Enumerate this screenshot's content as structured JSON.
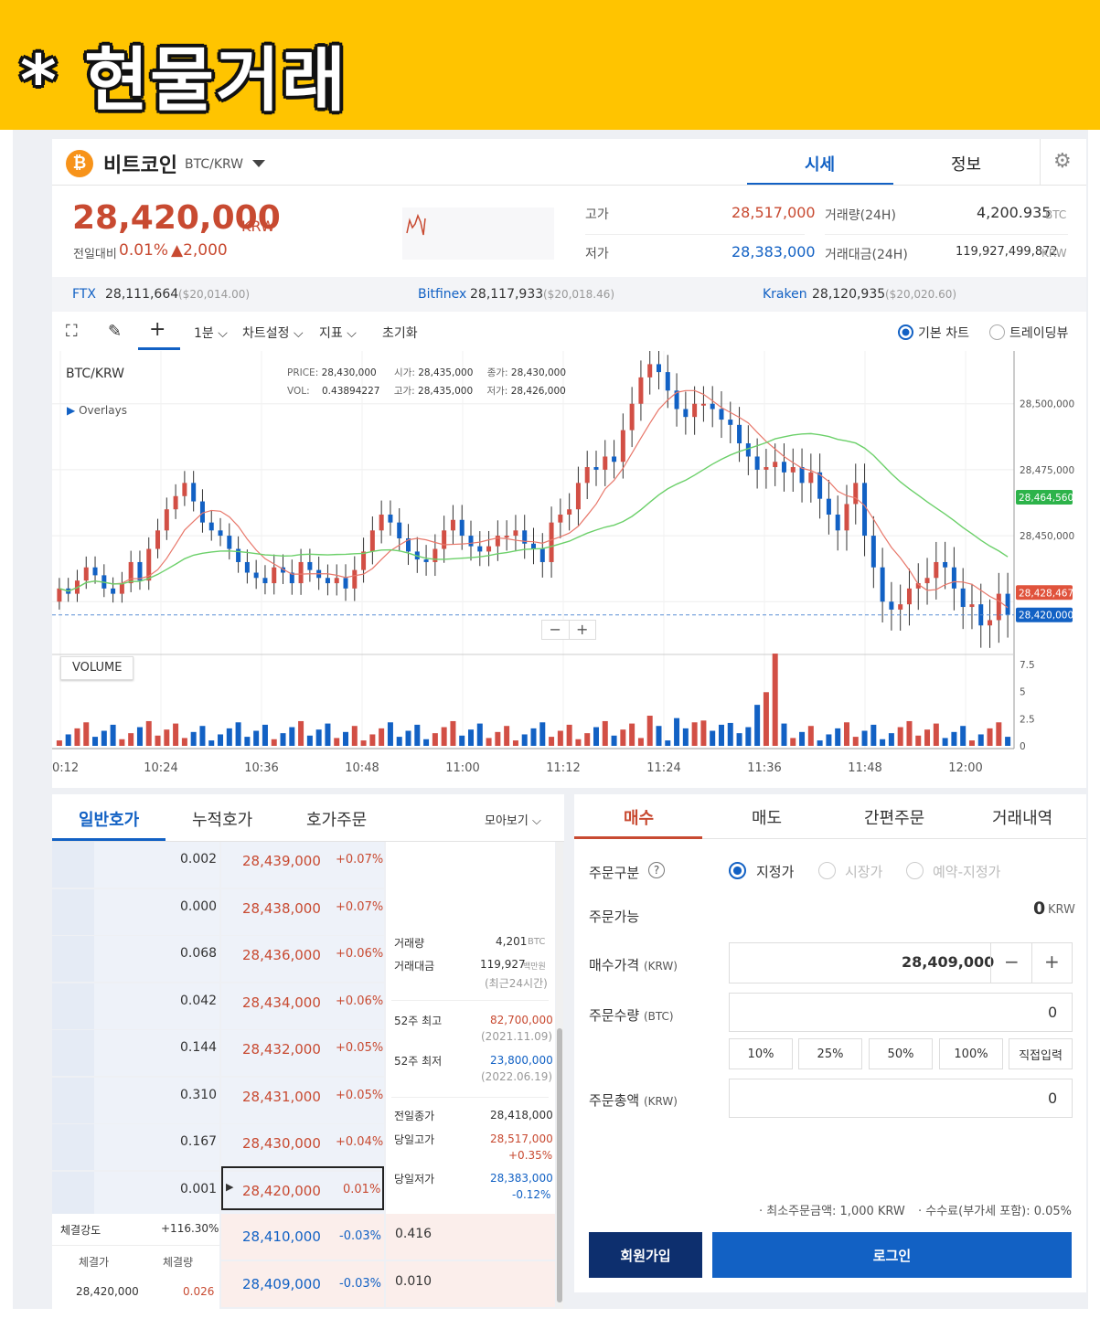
{
  "banner": {
    "title": "* 현물거래"
  },
  "header": {
    "coin_name": "비트코인",
    "pair": "BTC/KRW",
    "tabs": [
      "시세",
      "정보"
    ]
  },
  "price": {
    "current": "28,420,000",
    "unit": "KRW",
    "change_label": "전일대비",
    "change_pct": "0.01%",
    "change_amt": "▲2,000"
  },
  "stats": {
    "high_label": "고가",
    "high": "28,517,000",
    "low_label": "저가",
    "low": "28,383,000",
    "vol_label": "거래량(24H)",
    "vol": "4,200.935",
    "vol_unit": "BTC",
    "amt_label": "거래대금(24H)",
    "amt": "119,927,499,872",
    "amt_unit": "KRW"
  },
  "exchanges": [
    {
      "name": "FTX",
      "price": "28,111,664",
      "usd": "($20,014.00)"
    },
    {
      "name": "Bitfinex",
      "price": "28,117,933",
      "usd": "($20,018.46)"
    },
    {
      "name": "Kraken",
      "price": "28,120,935",
      "usd": "($20,020.60)"
    }
  ],
  "toolbar": {
    "interval": "1분",
    "settings": "차트설정",
    "indicator": "지표",
    "reset": "초기화",
    "basic": "기본 차트",
    "tv": "트레이딩뷰"
  },
  "chart_info": {
    "symbol": "BTC/KRW",
    "overlays": "Overlays",
    "price_l": "PRICE:",
    "price": "28,430,000",
    "open_l": "시가:",
    "open": "28,435,000",
    "close_l": "종가:",
    "close": "28,430,000",
    "vol_l": "VOL:",
    "vol": "0.43894227",
    "high_l": "고가:",
    "high": "28,435,000",
    "low_l": "저가:",
    "low": "28,426,000",
    "volume_title": "VOLUME"
  },
  "chart_data": {
    "type": "candlestick",
    "y_ticks": [
      "28,500,000",
      "28,475,000",
      "28,450,000"
    ],
    "ylim": [
      28405000,
      28520000
    ],
    "price_tags": [
      {
        "label": "28,464,560",
        "value": 28464560,
        "color": "#2db34a"
      },
      {
        "label": "28,428,467",
        "value": 28428467,
        "color": "#e0533c"
      },
      {
        "label": "28,420,000",
        "value": 28420000,
        "color": "#1261c4"
      }
    ],
    "x_labels": [
      "0:12",
      "10:24",
      "10:36",
      "10:48",
      "11:00",
      "11:12",
      "11:24",
      "11:36",
      "11:48",
      "12:00"
    ],
    "vol_ticks": [
      "7.5",
      "5",
      "2.5",
      "0"
    ]
  },
  "orderbook": {
    "tabs": [
      "일반호가",
      "누적호가",
      "호가주문"
    ],
    "view": "모아보기",
    "asks": [
      {
        "qty": "0.002",
        "price": "28,439,000",
        "pct": "+0.07%"
      },
      {
        "qty": "0.000",
        "price": "28,438,000",
        "pct": "+0.07%"
      },
      {
        "qty": "0.068",
        "price": "28,436,000",
        "pct": "+0.06%"
      },
      {
        "qty": "0.042",
        "price": "28,434,000",
        "pct": "+0.06%"
      },
      {
        "qty": "0.144",
        "price": "28,432,000",
        "pct": "+0.05%"
      },
      {
        "qty": "0.310",
        "price": "28,431,000",
        "pct": "+0.05%"
      },
      {
        "qty": "0.167",
        "price": "28,430,000",
        "pct": "+0.04%"
      },
      {
        "qty": "0.001",
        "price": "28,420,000",
        "pct": "0.01%"
      }
    ],
    "bids": [
      {
        "price": "28,410,000",
        "pct": "-0.03%",
        "qty": "0.416"
      },
      {
        "price": "28,409,000",
        "pct": "-0.03%",
        "qty": "0.010"
      }
    ],
    "strength_l": "체결강도",
    "strength": "+116.30%",
    "exec_price_l": "체결가",
    "exec_qty_l": "체결량",
    "exec_price": "28,420,000",
    "exec_qty": "0.026"
  },
  "info": {
    "vol_l": "거래량",
    "vol": "4,201",
    "vol_u": "BTC",
    "amt_l": "거래대금",
    "amt": "119,927",
    "amt_u": "백만원",
    "amt_note": "(최근24시간)",
    "h52_l": "52주 최고",
    "h52": "82,700,000",
    "h52_d": "(2021.11.09)",
    "l52_l": "52주 최저",
    "l52": "23,800,000",
    "l52_d": "(2022.06.19)",
    "prev_l": "전일종가",
    "prev": "28,418,000",
    "dh_l": "당일고가",
    "dh": "28,517,000",
    "dh_p": "+0.35%",
    "dl_l": "당일저가",
    "dl": "28,383,000",
    "dl_p": "-0.12%"
  },
  "order": {
    "tabs": [
      "매수",
      "매도",
      "간편주문",
      "거래내역"
    ],
    "type_l": "주문구분",
    "types": [
      "지정가",
      "시장가",
      "예약-지정가"
    ],
    "avail_l": "주문가능",
    "avail": "0",
    "avail_u": "KRW",
    "price_l": "매수가격",
    "price_u": "(KRW)",
    "price": "28,409,000",
    "qty_l": "주문수량",
    "qty_u": "(BTC)",
    "qty": "0",
    "pcts": [
      "10%",
      "25%",
      "50%",
      "100%",
      "직접입력"
    ],
    "total_l": "주문총액",
    "total_u": "(KRW)",
    "total": "0",
    "min_note": "최소주문금액: 1,000 KRW",
    "fee_note": "수수료(부가세 포함): 0.05%",
    "signup": "회원가입",
    "login": "로그인"
  }
}
